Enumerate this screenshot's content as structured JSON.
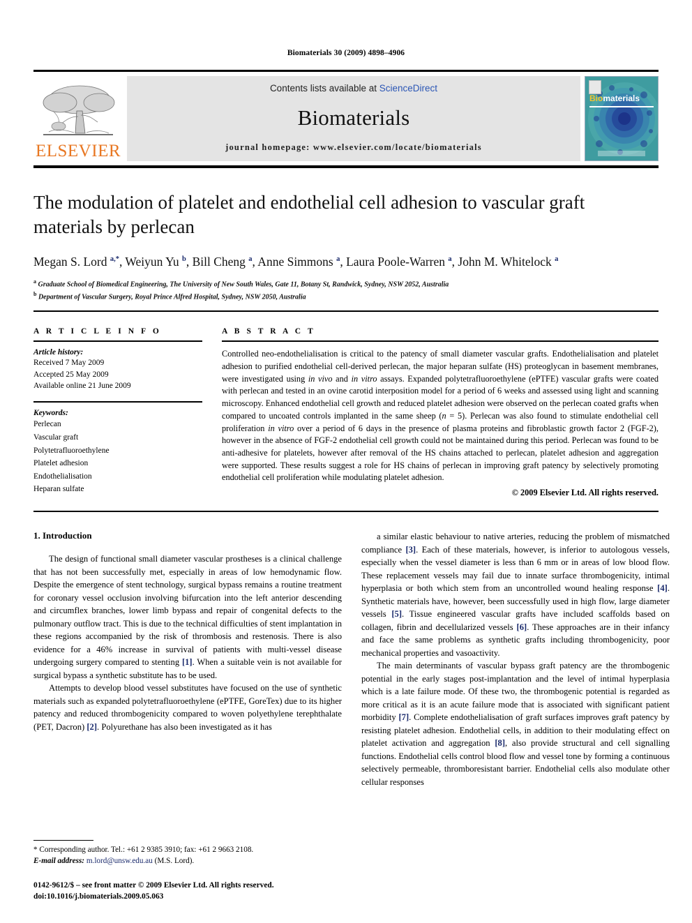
{
  "running_head": "Biomaterials 30 (2009) 4898–4906",
  "masthead": {
    "contents_prefix": "Contents lists available at ",
    "sciencedirect": "ScienceDirect",
    "journal_name": "Biomaterials",
    "homepage": "journal homepage: www.elsevier.com/locate/biomaterials",
    "publisher_wordmark": "ELSEVIER",
    "cover_title_bio": "Bio",
    "cover_title_rest": "materials",
    "accent_orange": "#E87722",
    "link_blue": "#2b56b5",
    "cover_teal": "#2f8f94"
  },
  "article": {
    "title": "The modulation of platelet and endothelial cell adhesion to vascular graft materials by perlecan",
    "authors_html": "Megan S. Lord <sup>a,*</sup>, Weiyun Yu <sup>b</sup>, Bill Cheng <sup>a</sup>, Anne Simmons <sup>a</sup>, Laura Poole-Warren <sup>a</sup>, John M. Whitelock <sup>a</sup>",
    "affiliations": [
      "<sup>a</sup> Graduate School of Biomedical Engineering, The University of New South Wales, Gate 11, Botany St, Randwick, Sydney, NSW 2052, Australia",
      "<sup>b</sup> Department of Vascular Surgery, Royal Prince Alfred Hospital, Sydney, NSW 2050, Australia"
    ]
  },
  "article_info": {
    "heading": "A R T I C L E   I N F O",
    "history_label": "Article history:",
    "history": [
      "Received 7 May 2009",
      "Accepted 25 May 2009",
      "Available online 21 June 2009"
    ],
    "keywords_label": "Keywords:",
    "keywords": [
      "Perlecan",
      "Vascular graft",
      "Polytetrafluoroethylene",
      "Platelet adhesion",
      "Endothelialisation",
      "Heparan sulfate"
    ]
  },
  "abstract": {
    "heading": "A B S T R A C T",
    "text_html": "Controlled neo-endothelialisation is critical to the patency of small diameter vascular grafts. Endothelialisation and platelet adhesion to purified endothelial cell-derived perlecan, the major heparan sulfate (HS) proteoglycan in basement membranes, were investigated using <i>in vivo</i> and <i>in vitro</i> assays. Expanded polytetrafluoroethylene (ePTFE) vascular grafts were coated with perlecan and tested in an ovine carotid interposition model for a period of 6 weeks and assessed using light and scanning microscopy. Enhanced endothelial cell growth and reduced platelet adhesion were observed on the perlecan coated grafts when compared to uncoated controls implanted in the same sheep (<i>n</i> = 5). Perlecan was also found to stimulate endothelial cell proliferation <i>in vitro</i> over a period of 6 days in the presence of plasma proteins and fibroblastic growth factor 2 (FGF-2), however in the absence of FGF-2 endothelial cell growth could not be maintained during this period. Perlecan was found to be anti-adhesive for platelets, however after removal of the HS chains attached to perlecan, platelet adhesion and aggregation were supported. These results suggest a role for HS chains of perlecan in improving graft patency by selectively promoting endothelial cell proliferation while modulating platelet adhesion.",
    "copyright": "© 2009 Elsevier Ltd. All rights reserved."
  },
  "introduction": {
    "section_number_title": "1.  Introduction",
    "left_paragraphs_html": [
      "The design of functional small diameter vascular prostheses is a clinical challenge that has not been successfully met, especially in areas of low hemodynamic flow. Despite the emergence of stent technology, surgical bypass remains a routine treatment for coronary vessel occlusion involving bifurcation into the left anterior descending and circumflex branches, lower limb bypass and repair of congenital defects to the pulmonary outflow tract. This is due to the technical difficulties of stent implantation in these regions accompanied by the risk of thrombosis and restenosis. There is also evidence for a 46% increase in survival of patients with multi-vessel disease undergoing surgery compared to stenting <span class=\"ref\">[1]</span>. When a suitable vein is not available for surgical bypass a synthetic substitute has to be used.",
      "Attempts to develop blood vessel substitutes have focused on the use of synthetic materials such as expanded polytetrafluoroethylene (ePTFE, GoreTex) due to its higher patency and reduced thrombogenicity compared to woven polyethylene terephthalate (PET, Dacron) <span class=\"ref\">[2]</span>. Polyurethane has also been investigated as it has"
    ],
    "right_paragraphs_html": [
      "a similar elastic behaviour to native arteries, reducing the problem of mismatched compliance <span class=\"ref\">[3]</span>. Each of these materials, however, is inferior to autologous vessels, especially when the vessel diameter is less than 6 mm or in areas of low blood flow. These replacement vessels may fail due to innate surface thrombogenicity, intimal hyperplasia or both which stem from an uncontrolled wound healing response <span class=\"ref\">[4]</span>. Synthetic materials have, however, been successfully used in high flow, large diameter vessels <span class=\"ref\">[5]</span>. Tissue engineered vascular grafts have included scaffolds based on collagen, fibrin and decellularized vessels <span class=\"ref\">[6]</span>. These approaches are in their infancy and face the same problems as synthetic grafts including thrombogenicity, poor mechanical properties and vasoactivity.",
      "The main determinants of vascular bypass graft patency are the thrombogenic potential in the early stages post-implantation and the level of intimal hyperplasia which is a late failure mode. Of these two, the thrombogenic potential is regarded as more critical as it is an acute failure mode that is associated with significant patient morbidity <span class=\"ref\">[7]</span>. Complete endothelialisation of graft surfaces improves graft patency by resisting platelet adhesion. Endothelial cells, in addition to their modulating effect on platelet activation and aggregation <span class=\"ref\">[8]</span>, also provide structural and cell signalling functions. Endothelial cells control blood flow and vessel tone by forming a continuous selectively permeable, thromboresistant barrier. Endothelial cells also modulate other cellular responses"
    ]
  },
  "footnotes": {
    "corresponding_html": "* Corresponding author. Tel.: +61 2 9385 3910; fax: +61 2 9663 2108.",
    "email_html": "<span class=\"ital\">E-mail address:</span> <span class=\"fn-mail\">m.lord@unsw.edu.au</span> (M.S. Lord).",
    "issn_line": "0142-9612/$ – see front matter © 2009 Elsevier Ltd. All rights reserved.",
    "doi_line": "doi:10.1016/j.biomaterials.2009.05.063"
  }
}
